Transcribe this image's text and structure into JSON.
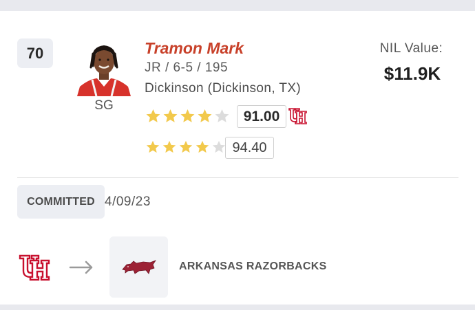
{
  "player": {
    "rank": "70",
    "name": "Tramon Mark",
    "position": "SG",
    "class_size": "JR / 6-5 / 195",
    "school": "Dickinson (Dickinson, TX)"
  },
  "ratings": [
    {
      "stars": 4,
      "max_stars": 5,
      "score": "91.00",
      "school_logo": "uh-logo"
    },
    {
      "stars": 4,
      "max_stars": 5,
      "score": "94.40"
    }
  ],
  "nil": {
    "label": "NIL Value:",
    "value": "$11.9K"
  },
  "transfer": {
    "status": "COMMITTED",
    "date": "4/09/23",
    "from_logo": "uh-logo",
    "arrow_icon": "arrow-right-icon",
    "to_logo": "razorback-logo",
    "destination": "ARKANSAS RAZORBACKS"
  },
  "colors": {
    "name": "#c8412a",
    "star_filled": "#f2c94c",
    "star_empty": "#dcdcdc",
    "houston_red": "#c8102e",
    "arkansas_red": "#9d2235"
  }
}
